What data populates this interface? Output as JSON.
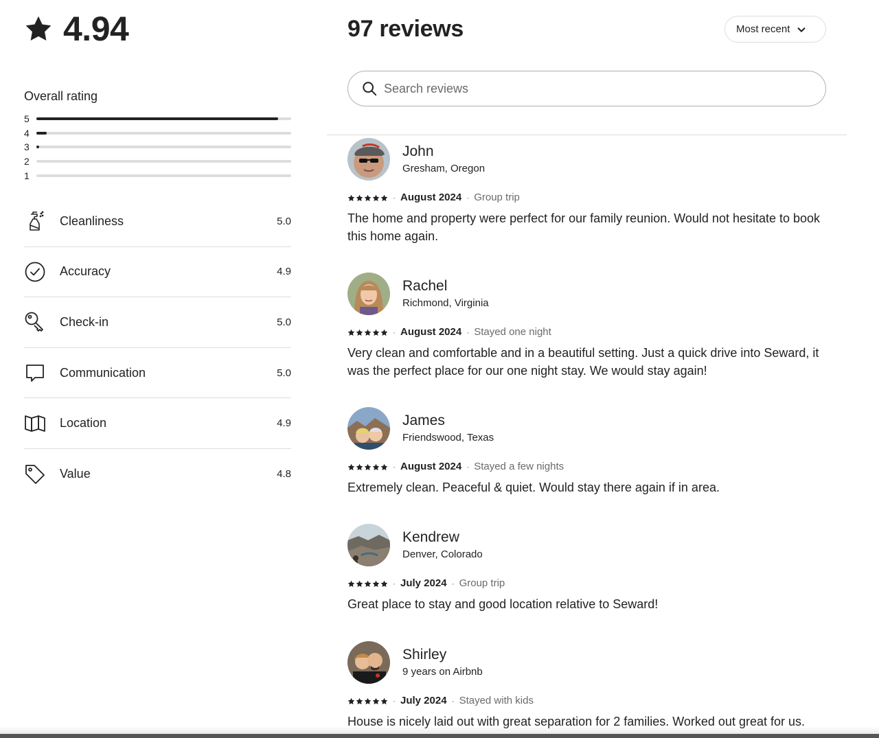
{
  "summary": {
    "rating": "4.94",
    "overall_title": "Overall rating",
    "histogram": [
      {
        "label": "5",
        "fraction": 0.95
      },
      {
        "label": "4",
        "fraction": 0.04
      },
      {
        "label": "3",
        "fraction": 0.01
      },
      {
        "label": "2",
        "fraction": 0.0
      },
      {
        "label": "1",
        "fraction": 0.0
      }
    ],
    "categories": [
      {
        "label": "Cleanliness",
        "value": "5.0",
        "icon": "spray-bottle-icon"
      },
      {
        "label": "Accuracy",
        "value": "4.9",
        "icon": "check-circle-icon"
      },
      {
        "label": "Check-in",
        "value": "5.0",
        "icon": "key-icon"
      },
      {
        "label": "Communication",
        "value": "5.0",
        "icon": "chat-bubble-icon"
      },
      {
        "label": "Location",
        "value": "4.9",
        "icon": "map-icon"
      },
      {
        "label": "Value",
        "value": "4.8",
        "icon": "price-tag-icon"
      }
    ]
  },
  "header": {
    "title": "97 reviews",
    "sort_label": "Most recent"
  },
  "search": {
    "placeholder": "Search reviews"
  },
  "reviews": [
    {
      "name": "John",
      "location": "Gresham, Oregon",
      "date": "August 2024",
      "trip": "Group trip",
      "text": "The home and property were perfect for our family reunion. Would not hesitate to book this home again."
    },
    {
      "name": "Rachel",
      "location": "Richmond, Virginia",
      "date": "August 2024",
      "trip": "Stayed one night",
      "text": "Very clean and comfortable and in a beautiful setting. Just a quick drive into Seward, it was the perfect place for our one night stay. We would stay again!"
    },
    {
      "name": "James",
      "location": "Friendswood, Texas",
      "date": "August 2024",
      "trip": "Stayed a few nights",
      "text": "Extremely clean. Peaceful & quiet. Would stay there again if in area."
    },
    {
      "name": "Kendrew",
      "location": "Denver, Colorado",
      "date": "July 2024",
      "trip": "Group trip",
      "text": "Great place to stay and good location relative to Seward!"
    },
    {
      "name": "Shirley",
      "location": "9 years on Airbnb",
      "date": "July 2024",
      "trip": "Stayed with kids",
      "text": "House is nicely laid out with great separation for 2 families. Worked out great for us."
    }
  ],
  "colors": {
    "text": "#222222",
    "muted": "#6a6a6a",
    "divider": "#dddddd",
    "track": "#dddddd"
  }
}
